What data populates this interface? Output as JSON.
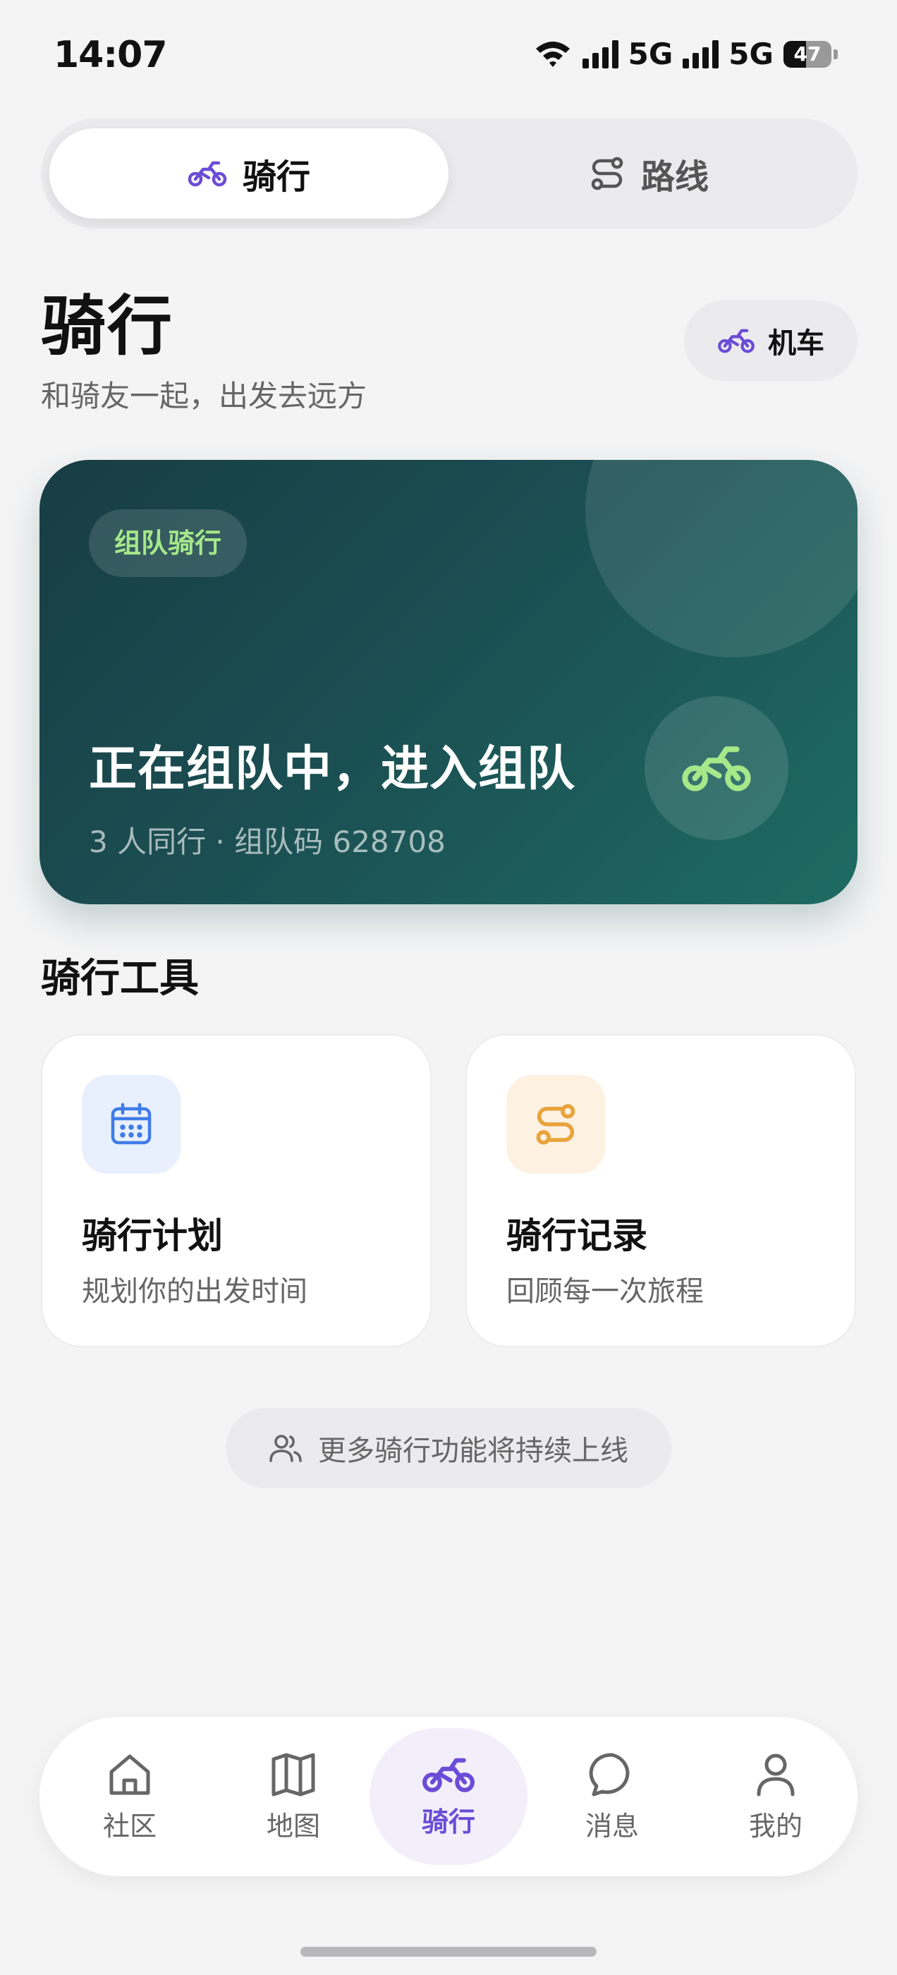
{
  "status_bar": {
    "time": "14:07",
    "network1": "5G",
    "network2": "5G",
    "battery": "47",
    "battery_level": 0.47
  },
  "segmented": {
    "active": {
      "label": "骑行",
      "icon": "motorbike-icon"
    },
    "inactive": {
      "label": "路线",
      "icon": "route-icon"
    }
  },
  "header": {
    "title": "骑行",
    "subtitle": "和骑友一起，出发去远方",
    "vehicle_chip": {
      "label": "机车",
      "icon": "motorbike-icon"
    }
  },
  "hero": {
    "badge": "组队骑行",
    "title": "正在组队中，进入组队",
    "subtitle": "3 人同行 · 组队码 628708",
    "icon": "motorbike-icon"
  },
  "tools": {
    "section_title": "骑行工具",
    "items": [
      {
        "title": "骑行计划",
        "desc": "规划你的出发时间",
        "icon": "calendar-icon"
      },
      {
        "title": "骑行记录",
        "desc": "回顾每一次旅程",
        "icon": "route-icon"
      }
    ]
  },
  "notice": {
    "text": "更多骑行功能将持续上线",
    "icon": "users-icon"
  },
  "nav": {
    "items": [
      {
        "label": "社区",
        "icon": "home-icon"
      },
      {
        "label": "地图",
        "icon": "map-icon"
      },
      {
        "label": "骑行",
        "icon": "motorbike-icon",
        "active": true
      },
      {
        "label": "消息",
        "icon": "message-icon"
      },
      {
        "label": "我的",
        "icon": "user-icon"
      }
    ]
  },
  "colors": {
    "accent": "#6b4cd6",
    "hero_start": "#173d43",
    "hero_end": "#1e6b62",
    "hero_badge_text": "#a6e88a",
    "calendar_blue": "#3f7be8",
    "route_orange": "#e8a33a"
  }
}
